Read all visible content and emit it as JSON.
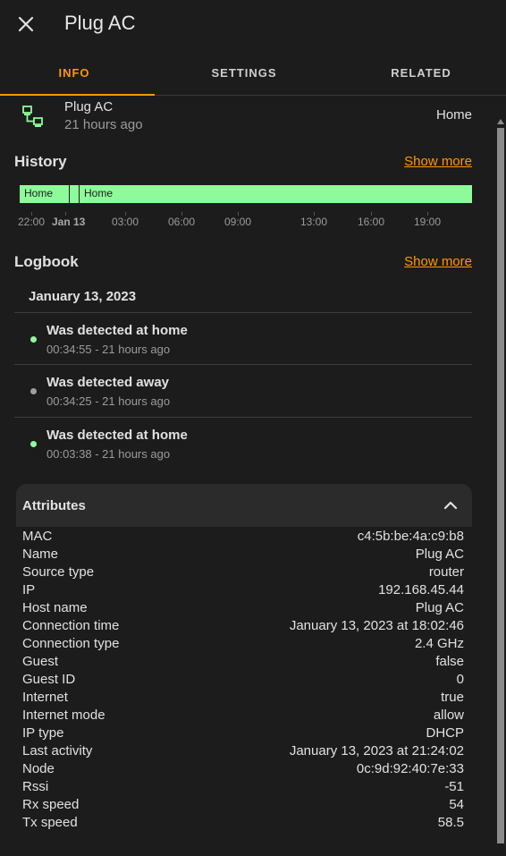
{
  "dialog": {
    "title": "Plug AC"
  },
  "tabs": [
    {
      "label": "INFO",
      "active": true
    },
    {
      "label": "SETTINGS",
      "active": false
    },
    {
      "label": "RELATED",
      "active": false
    }
  ],
  "entity": {
    "name": "Plug AC",
    "last_changed": "21 hours ago",
    "state": "Home",
    "icon": "lan-connect-icon"
  },
  "history": {
    "title": "History",
    "show_more": "Show more",
    "segments": [
      {
        "label": "Home",
        "from": 0.0,
        "to": 0.111
      },
      {
        "label": "",
        "from": 0.111,
        "to": 0.133
      },
      {
        "label": "Home",
        "from": 0.133,
        "to": 1.0
      }
    ],
    "ticks": [
      {
        "label": "22:00",
        "bold": false
      },
      {
        "label": "Jan 13",
        "bold": true
      },
      {
        "label": "03:00",
        "bold": false
      },
      {
        "label": "06:00",
        "bold": false
      },
      {
        "label": "09:00",
        "bold": false
      },
      {
        "label": "13:00",
        "bold": false
      },
      {
        "label": "16:00",
        "bold": false
      },
      {
        "label": "19:00",
        "bold": false
      }
    ],
    "state_color": "#8dfb9a"
  },
  "logbook": {
    "title": "Logbook",
    "show_more": "Show more",
    "date": "January 13, 2023",
    "entries": [
      {
        "message": "Was detected at home",
        "time": "00:34:55 - 21 hours ago",
        "dot_color": "#8dfb9a"
      },
      {
        "message": "Was detected away",
        "time": "00:34:25 - 21 hours ago",
        "dot_color": "#9e9e9e"
      },
      {
        "message": "Was detected at home",
        "time": "00:03:38 - 21 hours ago",
        "dot_color": "#8dfb9a"
      }
    ]
  },
  "attributes": {
    "title": "Attributes",
    "rows": [
      {
        "key": "MAC",
        "value": "c4:5b:be:4a:c9:b8"
      },
      {
        "key": "Name",
        "value": "Plug AC"
      },
      {
        "key": "Source type",
        "value": "router"
      },
      {
        "key": "IP",
        "value": "192.168.45.44"
      },
      {
        "key": "Host name",
        "value": "Plug AC"
      },
      {
        "key": "Connection time",
        "value": "January 13, 2023 at 18:02:46"
      },
      {
        "key": "Connection type",
        "value": "2.4 GHz"
      },
      {
        "key": "Guest",
        "value": "false"
      },
      {
        "key": "Guest ID",
        "value": "0"
      },
      {
        "key": "Internet",
        "value": "true"
      },
      {
        "key": "Internet mode",
        "value": "allow"
      },
      {
        "key": "IP type",
        "value": "DHCP"
      },
      {
        "key": "Last activity",
        "value": "January 13, 2023 at 21:24:02"
      },
      {
        "key": "Node",
        "value": "0c:9d:92:40:7e:33"
      },
      {
        "key": "Rssi",
        "value": "-51"
      },
      {
        "key": "Rx speed",
        "value": "54"
      },
      {
        "key": "Tx speed",
        "value": "58.5"
      }
    ]
  },
  "colors": {
    "accent": "#ff9800",
    "background": "#1c1c1c",
    "card": "#2b2b2b",
    "home": "#8dfb9a",
    "away": "#9e9e9e"
  }
}
